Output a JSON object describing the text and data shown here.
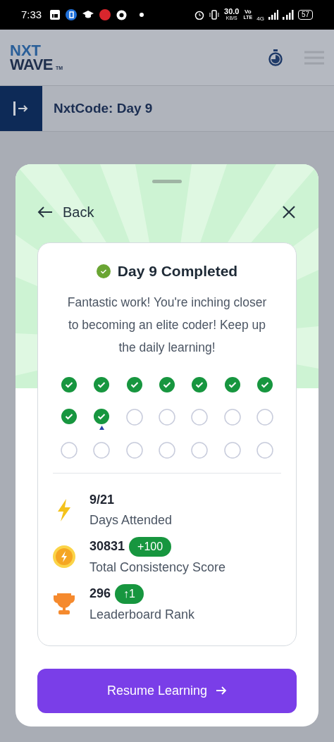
{
  "status_bar": {
    "time": "7:33",
    "speed": "30.0",
    "speed_unit": "KB/S",
    "volte_top": "Vo",
    "volte_bottom": "LTE",
    "network": "4G",
    "battery": "57"
  },
  "header": {
    "logo_top": "NXT",
    "logo_bottom": "WAVE",
    "logo_mark": "TM"
  },
  "subheader": {
    "title": "NxtCode: Day 9"
  },
  "sheet": {
    "back": "Back",
    "card": {
      "title": "Day 9 Completed",
      "message": "Fantastic work! You're inching closer to becoming an elite coder! Keep up the daily learning!",
      "days": [
        {
          "done": true,
          "current": false
        },
        {
          "done": true,
          "current": false
        },
        {
          "done": true,
          "current": false
        },
        {
          "done": true,
          "current": false
        },
        {
          "done": true,
          "current": false
        },
        {
          "done": true,
          "current": false
        },
        {
          "done": true,
          "current": false
        },
        {
          "done": true,
          "current": false
        },
        {
          "done": true,
          "current": true
        },
        {
          "done": false,
          "current": false
        },
        {
          "done": false,
          "current": false
        },
        {
          "done": false,
          "current": false
        },
        {
          "done": false,
          "current": false
        },
        {
          "done": false,
          "current": false
        },
        {
          "done": false,
          "current": false
        },
        {
          "done": false,
          "current": false
        },
        {
          "done": false,
          "current": false
        },
        {
          "done": false,
          "current": false
        },
        {
          "done": false,
          "current": false
        },
        {
          "done": false,
          "current": false
        },
        {
          "done": false,
          "current": false
        }
      ],
      "stats": [
        {
          "kind": "bolt",
          "value": "9/21",
          "label": "Days Attended"
        },
        {
          "kind": "coin",
          "value": "30831",
          "badge": "+100",
          "label": "Total Consistency Score"
        },
        {
          "kind": "trophy",
          "value": "296",
          "badge": "↑1",
          "label": "Leaderboard Rank"
        }
      ]
    },
    "button": "Resume Learning"
  }
}
